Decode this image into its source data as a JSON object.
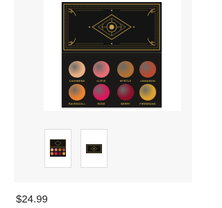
{
  "product": {
    "price": "$24.99"
  },
  "gallery": {
    "main_image": {
      "shades": [
        {
          "label": "CASHMERE",
          "color": "#e8b083"
        },
        {
          "label": "CLEVE",
          "color": "#e36e74"
        },
        {
          "label": "MYRTLE",
          "color": "#b06f33"
        },
        {
          "label": "CINNAMON",
          "color": "#b44a2e"
        },
        {
          "label": "RAVENSOLL",
          "color": "#ea8230"
        },
        {
          "label": "ROSE",
          "color": "#d8185a"
        },
        {
          "label": "BERRY",
          "color": "#8e0f2c"
        },
        {
          "label": "FIREBRAND",
          "color": "#dba12f"
        }
      ],
      "lid_color": "#141414",
      "gold_color": "#c8a24a"
    },
    "thumbnails": [
      {
        "name": "palette-open-thumbnail"
      },
      {
        "name": "palette-closed-thumbnail"
      }
    ]
  }
}
